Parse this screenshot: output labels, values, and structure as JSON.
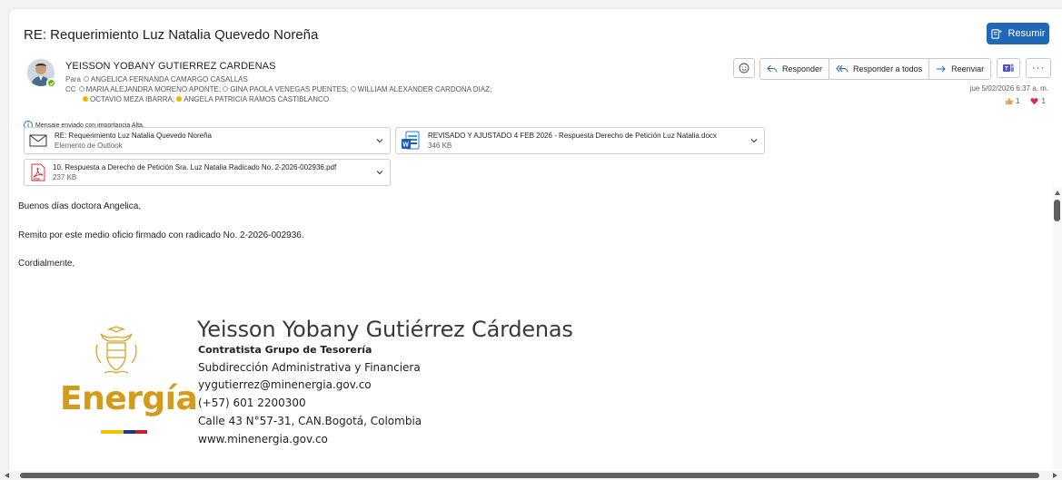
{
  "email": {
    "subject": "RE: Requerimiento Luz Natalia Quevedo Noreña",
    "summarize_label": "Resumir",
    "sender": "YEISSON YOBANY GUTIERREZ CARDENAS",
    "to_label": "Para",
    "to": [
      "ANGELICA FERNANDA CAMARGO CASALLAS"
    ],
    "cc_label": "CC",
    "cc": [
      "MARIA ALEJANDRA MORENO APONTE;",
      "GINA PAOLA VENEGAS PUENTES;",
      "WILLIAM ALEXANDER CARDONA DIAZ;",
      "OCTAVIO MEZA IBARRA;",
      "ANGELA PATRICIA RAMOS CASTIBLANCO"
    ],
    "importance_note": "Mensaje enviado con importancia Alta.",
    "timestamp": "jue 5/02/2026 6:37 a. m.",
    "reactions": [
      {
        "icon": "thumbs-up-icon",
        "count": "1",
        "color": "#e8a33d"
      },
      {
        "icon": "heart-icon",
        "count": "1",
        "color": "#e0245e"
      }
    ]
  },
  "toolbar": {
    "responder": "Responder",
    "responder_todos": "Responder a todos",
    "reenviar": "Reenviar"
  },
  "attachments": [
    {
      "name": "RE: Requerimiento Luz Natalia Quevedo Noreña",
      "sub": "Elemento de Outlook",
      "icon": "mail-icon"
    },
    {
      "name": "REVISADO Y AJUSTADO 4 FEB 2026 - Respuesta Derecho de Petición Luz Natalia.docx",
      "sub": "346 KB",
      "icon": "word-icon"
    },
    {
      "name": "10. Respuesta a Derecho de Petición Sra. Luz Natalia Radicado No. 2-2026-002936.pdf",
      "sub": "237 KB",
      "icon": "pdf-icon"
    }
  ],
  "body": {
    "greeting": "Buenos días doctora Angelica,",
    "line1": "Remito por este medio oficio firmado con radicado No. 2-2026-002936.",
    "closing": "Cordialmente,"
  },
  "signature": {
    "name": "Yeisson Yobany Gutiérrez Cárdenas",
    "role": "Contratista Grupo de Tesorería",
    "dept": "Subdirección Administrativa y Financiera",
    "email": "yygutierrez@minenergia.gov.co",
    "phone": "(+57) 601 2200300",
    "address": "Calle 43 N°57-31, CAN.Bogotá, Colombia",
    "web": "www.minenergia.gov.co",
    "logo_text": "Energía"
  },
  "colors": {
    "accent": "#2266b8",
    "logo_gold": "#d49a1a",
    "flag_yellow": "#f2c300",
    "flag_blue": "#1a3a8c",
    "flag_red": "#d11a2a"
  }
}
